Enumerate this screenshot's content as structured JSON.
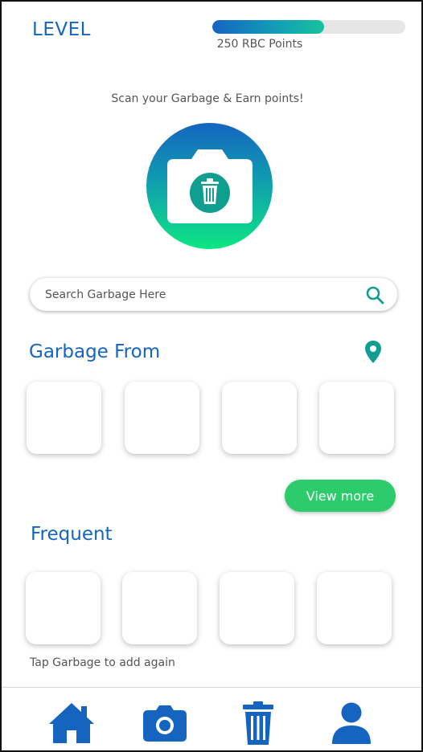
{
  "header": {
    "level_label": "LEVEL",
    "progress_fraction": 0.58,
    "points_label": "250 RBC Points"
  },
  "scan": {
    "caption": "Scan your Garbage & Earn points!",
    "icon": "camera-trash-icon"
  },
  "search": {
    "placeholder": "Search Garbage Here",
    "value": "",
    "icon": "search-icon"
  },
  "garbage_from": {
    "title": "Garbage From",
    "icon": "location-pin-icon",
    "view_more_label": "View more"
  },
  "frequent": {
    "title": "Frequent",
    "hint": "Tap Garbage to add again"
  },
  "bottom_nav": {
    "items": [
      {
        "icon": "home-icon"
      },
      {
        "icon": "camera-icon"
      },
      {
        "icon": "trash-icon"
      },
      {
        "icon": "profile-icon"
      }
    ]
  },
  "colors": {
    "primary": "#1565c0",
    "accent_green": "#2ccb6b",
    "teal": "#0f9e8f"
  }
}
